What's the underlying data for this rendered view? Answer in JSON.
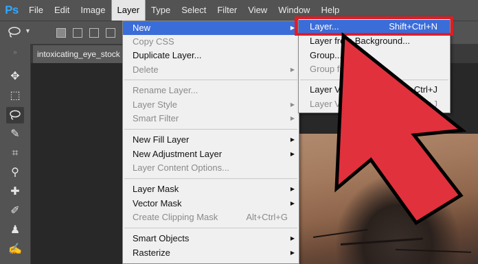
{
  "app": {
    "logo": "Ps"
  },
  "menubar": [
    "File",
    "Edit",
    "Image",
    "Layer",
    "Type",
    "Select",
    "Filter",
    "View",
    "Window",
    "Help"
  ],
  "document": {
    "tab_title": "intoxicating_eye_stock"
  },
  "layer_menu": {
    "new": "New",
    "copy_css": "Copy CSS",
    "duplicate_layer": "Duplicate Layer...",
    "delete": "Delete",
    "rename_layer": "Rename Layer...",
    "layer_style": "Layer Style",
    "smart_filter": "Smart Filter",
    "new_fill_layer": "New Fill Layer",
    "new_adjustment_layer": "New Adjustment Layer",
    "layer_content_options": "Layer Content Options...",
    "layer_mask": "Layer Mask",
    "vector_mask": "Vector Mask",
    "create_clipping_mask": "Create Clipping Mask",
    "create_clipping_mask_shortcut": "Alt+Ctrl+G",
    "smart_objects": "Smart Objects",
    "rasterize": "Rasterize"
  },
  "new_submenu": {
    "layer": "Layer...",
    "layer_shortcut": "Shift+Ctrl+N",
    "layer_from_background": "Layer from Background...",
    "group": "Group...",
    "group_from_layers": "Group from Layers...",
    "layer_via_copy": "Layer Via Copy",
    "layer_via_copy_shortcut": "Ctrl+J",
    "layer_via_cut": "Layer Via Cut",
    "layer_via_cut_shortcut": "Shift+Ctrl+J"
  },
  "colors": {
    "highlight": "#3b6dd8",
    "annotation_red": "#e31b23",
    "ui_panel": "#535353"
  },
  "icons": [
    "lasso-icon",
    "move-tool-icon",
    "marquee-tool-icon",
    "lasso-tool-icon",
    "quick-select-tool-icon",
    "crop-tool-icon",
    "eyedropper-tool-icon",
    "healing-brush-tool-icon",
    "brush-tool-icon",
    "clone-stamp-tool-icon",
    "history-brush-tool-icon"
  ]
}
